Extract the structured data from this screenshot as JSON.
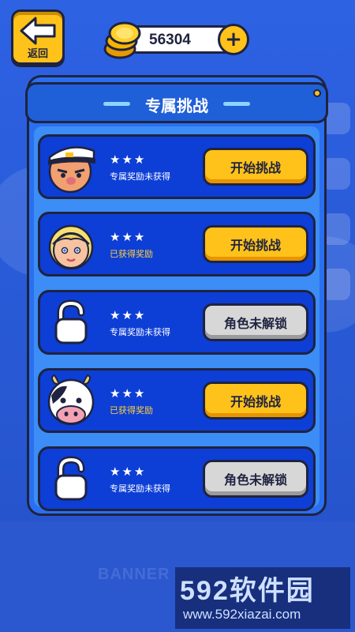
{
  "header": {
    "back_label": "返回",
    "coins": "56304",
    "add_symbol": "+"
  },
  "panel": {
    "title": "专属挑战"
  },
  "challenges": [
    {
      "character": "sailor-captain",
      "stars": "★★★",
      "status": "专属奖励未获得",
      "action": "开始挑战",
      "locked": false
    },
    {
      "character": "blonde-girl",
      "stars": "★★★",
      "status": "已获得奖励",
      "action": "开始挑战",
      "locked": false
    },
    {
      "character": "locked",
      "stars": "★★★",
      "status": "专属奖励未获得",
      "action": "角色未解锁",
      "locked": true
    },
    {
      "character": "cow",
      "stars": "★★★",
      "status": "已获得奖励",
      "action": "开始挑战",
      "locked": false
    },
    {
      "character": "locked",
      "stars": "★★★",
      "status": "专属奖励未获得",
      "action": "角色未解锁",
      "locked": true
    }
  ],
  "footer": {
    "banner": "BANNER"
  },
  "watermark": {
    "brand": "592软件园",
    "url": "www.592xiazai.com"
  },
  "colors": {
    "background": "#2a5bd8",
    "accent_yellow": "#ffc21a",
    "outline": "#1f2340",
    "row_blue": "#0d3ed6"
  }
}
